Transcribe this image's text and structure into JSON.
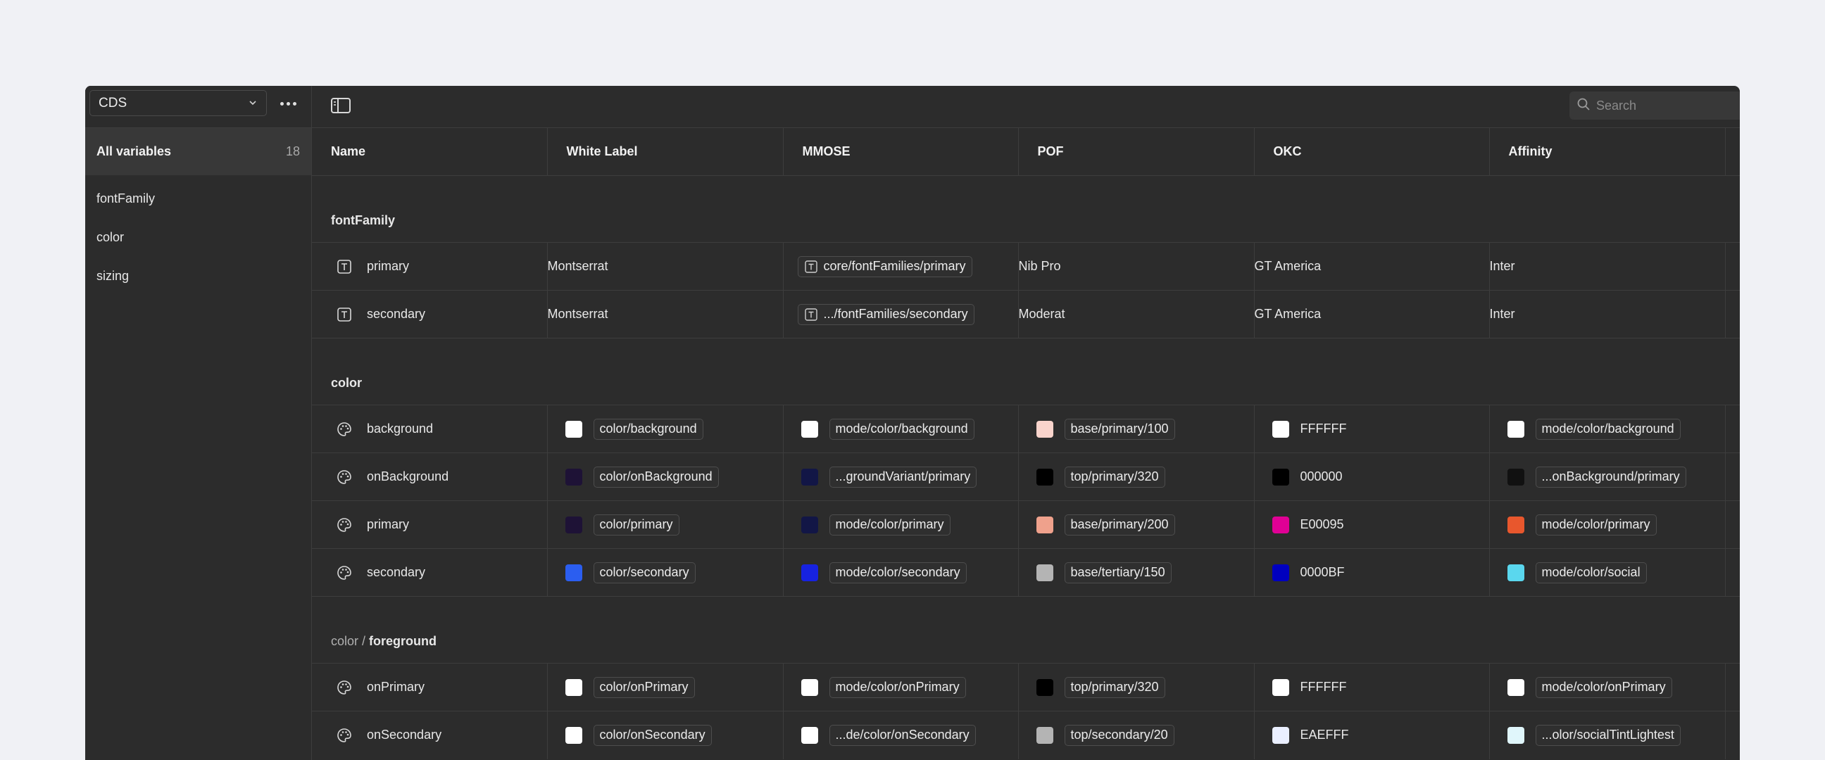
{
  "sidebar": {
    "collection": "CDS",
    "all_variables_label": "All variables",
    "all_variables_count": "18",
    "groups": [
      "fontFamily",
      "color",
      "sizing"
    ]
  },
  "search": {
    "placeholder": "Search"
  },
  "table": {
    "headers": [
      "Name",
      "White Label",
      "MMOSE",
      "POF",
      "OKC",
      "Affinity"
    ],
    "sections": [
      {
        "prefix": "",
        "title": "fontFamily",
        "rows": [
          {
            "icon": "text-variable-icon",
            "name": "primary",
            "cells": [
              {
                "text": "Montserrat"
              },
              {
                "alias": true,
                "text": "core/fontFamilies/primary"
              },
              {
                "text": "Nib Pro"
              },
              {
                "text": "GT America"
              },
              {
                "text": "Inter"
              }
            ]
          },
          {
            "icon": "text-variable-icon",
            "name": "secondary",
            "cells": [
              {
                "text": "Montserrat"
              },
              {
                "alias": true,
                "text": ".../fontFamilies/secondary"
              },
              {
                "text": "Moderat"
              },
              {
                "text": "GT America"
              },
              {
                "text": "Inter"
              }
            ]
          }
        ]
      },
      {
        "prefix": "",
        "title": "color",
        "rows": [
          {
            "icon": "palette-icon",
            "name": "background",
            "cells": [
              {
                "swatch": "#ffffff",
                "text": "color/background",
                "pill": true
              },
              {
                "swatch": "#ffffff",
                "text": "mode/color/background",
                "pill": true
              },
              {
                "swatch": "#f9d4cc",
                "text": "base/primary/100",
                "pill": true
              },
              {
                "swatch": "#ffffff",
                "text": "FFFFFF",
                "pill": false
              },
              {
                "swatch": "#ffffff",
                "text": "mode/color/background",
                "pill": true
              }
            ]
          },
          {
            "icon": "palette-icon",
            "name": "onBackground",
            "cells": [
              {
                "swatch": "#1e1236",
                "text": "color/onBackground",
                "pill": true
              },
              {
                "swatch": "#121646",
                "text": "...groundVariant/primary",
                "pill": true
              },
              {
                "swatch": "#000000",
                "text": "top/primary/320",
                "pill": true
              },
              {
                "swatch": "#000000",
                "text": "000000",
                "pill": false
              },
              {
                "swatch": "#111111",
                "text": "...onBackground/primary",
                "pill": true
              }
            ]
          },
          {
            "icon": "palette-icon",
            "name": "primary",
            "cells": [
              {
                "swatch": "#1e1236",
                "text": "color/primary",
                "pill": true
              },
              {
                "swatch": "#121646",
                "text": "mode/color/primary",
                "pill": true
              },
              {
                "swatch": "#efa18c",
                "text": "base/primary/200",
                "pill": true
              },
              {
                "swatch": "#e00095",
                "text": "E00095",
                "pill": false
              },
              {
                "swatch": "#e8572d",
                "text": "mode/color/primary",
                "pill": true
              }
            ]
          },
          {
            "icon": "palette-icon",
            "name": "secondary",
            "cells": [
              {
                "swatch": "#2b5ef0",
                "text": "color/secondary",
                "pill": true
              },
              {
                "swatch": "#1722e0",
                "text": "mode/color/secondary",
                "pill": true
              },
              {
                "swatch": "#b4b4b4",
                "text": "base/tertiary/150",
                "pill": true
              },
              {
                "swatch": "#0000bf",
                "text": "0000BF",
                "pill": false
              },
              {
                "swatch": "#5ad7ee",
                "text": "mode/color/social",
                "pill": true
              }
            ]
          }
        ]
      },
      {
        "prefix": "color / ",
        "title": "foreground",
        "rows": [
          {
            "icon": "palette-icon",
            "name": "onPrimary",
            "cells": [
              {
                "swatch": "#ffffff",
                "text": "color/onPrimary",
                "pill": true
              },
              {
                "swatch": "#ffffff",
                "text": "mode/color/onPrimary",
                "pill": true
              },
              {
                "swatch": "#000000",
                "text": "top/primary/320",
                "pill": true
              },
              {
                "swatch": "#ffffff",
                "text": "FFFFFF",
                "pill": false
              },
              {
                "swatch": "#ffffff",
                "text": "mode/color/onPrimary",
                "pill": true
              }
            ]
          },
          {
            "icon": "palette-icon",
            "name": "onSecondary",
            "cells": [
              {
                "swatch": "#ffffff",
                "text": "color/onSecondary",
                "pill": true
              },
              {
                "swatch": "#ffffff",
                "text": "...de/color/onSecondary",
                "pill": true
              },
              {
                "swatch": "#b4b4b4",
                "text": "top/secondary/20",
                "pill": true
              },
              {
                "swatch": "#eaefff",
                "text": "EAEFFF",
                "pill": false
              },
              {
                "swatch": "#e0f6fb",
                "text": "...olor/socialTintLightest",
                "pill": true
              }
            ]
          }
        ]
      }
    ]
  }
}
